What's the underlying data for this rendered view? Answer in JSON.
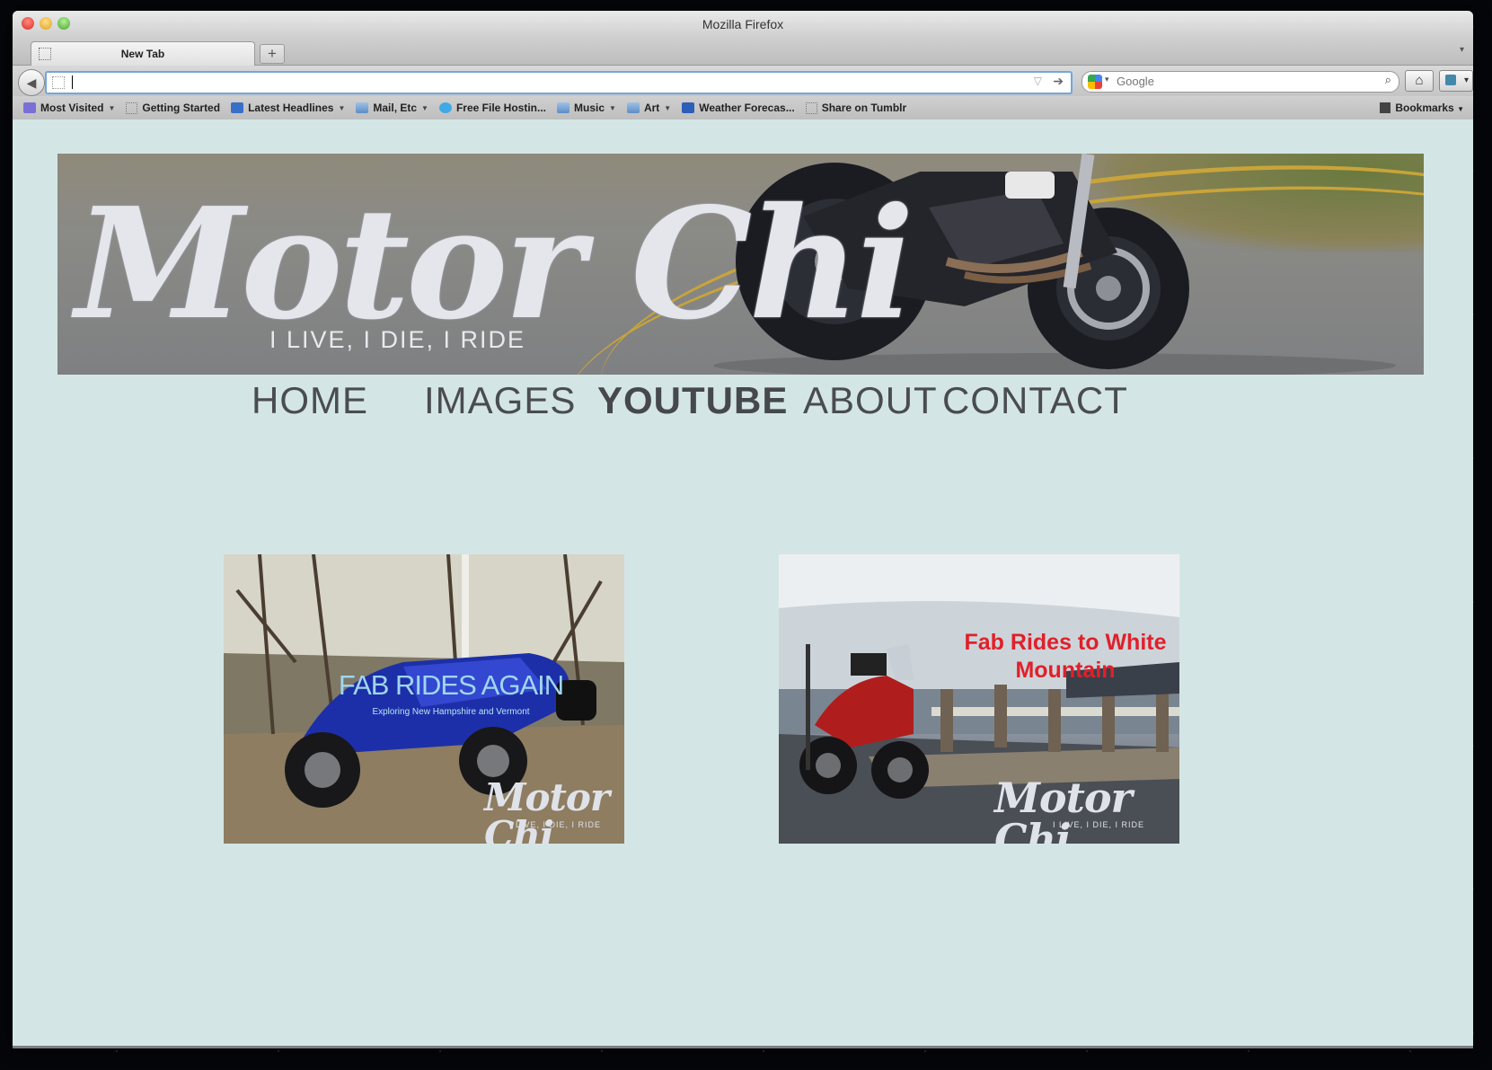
{
  "window": {
    "title": "Mozilla Firefox"
  },
  "tabs": [
    {
      "label": "New Tab"
    }
  ],
  "tab_controls": {
    "new_tab": "+",
    "list_all": "▾"
  },
  "toolbar": {
    "back_icon": "back-arrow-icon",
    "url_value": "",
    "search_placeholder": "Google",
    "home_icon": "home-icon"
  },
  "bookmarks": [
    {
      "label": "Most Visited",
      "icon": "smart-folder-icon",
      "dropdown": true
    },
    {
      "label": "Getting Started",
      "icon": "page-icon",
      "dropdown": false
    },
    {
      "label": "Latest Headlines",
      "icon": "rss-icon",
      "dropdown": true
    },
    {
      "label": "Mail, Etc",
      "icon": "folder-icon",
      "dropdown": true
    },
    {
      "label": "Free File Hostin...",
      "icon": "cloud-icon",
      "dropdown": false
    },
    {
      "label": "Music",
      "icon": "folder-icon",
      "dropdown": true
    },
    {
      "label": "Art",
      "icon": "folder-icon",
      "dropdown": true
    },
    {
      "label": "Weather Forecas...",
      "icon": "weather-icon",
      "dropdown": false
    },
    {
      "label": "Share on Tumblr",
      "icon": "page-icon",
      "dropdown": false
    }
  ],
  "bookmarks_menu": {
    "label": "Bookmarks"
  },
  "site": {
    "logo_text": "Motor Chi",
    "tagline": "I LIVE, I DIE, I RIDE",
    "nav": [
      {
        "label": "HOME",
        "active": false
      },
      {
        "label": "IMAGES",
        "active": false
      },
      {
        "label": "YOUTUBE",
        "active": true
      },
      {
        "label": "ABOUT",
        "active": false
      },
      {
        "label": "CONTACT",
        "active": false
      }
    ],
    "videos": [
      {
        "title": "FAB RIDES AGAIN",
        "subtitle": "Exploring New Hampshire and Vermont",
        "watermark": "Motor Chi",
        "watermark_sub": "I LIVE, I DIE, I RIDE"
      },
      {
        "title": "Fab Rides to White Mountain",
        "watermark": "Motor Chi",
        "watermark_sub": "I LIVE, I DIE, I RIDE"
      }
    ]
  },
  "colors": {
    "page_bg": "#d3e6e5",
    "nav_text": "#4a4c52",
    "title2": "#e0202a",
    "title1": "#9fd6ef"
  }
}
